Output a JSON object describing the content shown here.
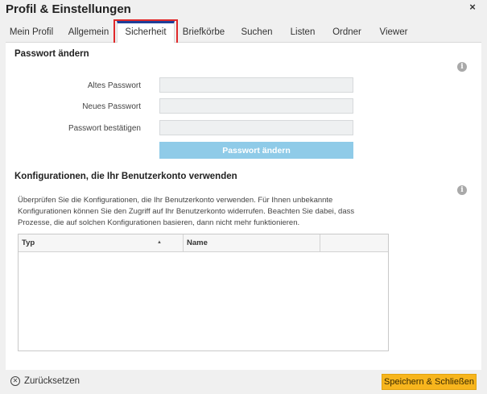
{
  "dialog": {
    "title": "Profil & Einstellungen",
    "close_symbol": "×"
  },
  "tabs": [
    {
      "label": "Mein Profil",
      "active": false
    },
    {
      "label": "Allgemein",
      "active": false
    },
    {
      "label": "Sicherheit",
      "active": true
    },
    {
      "label": "Briefkörbe",
      "active": false
    },
    {
      "label": "Suchen",
      "active": false
    },
    {
      "label": "Listen",
      "active": false
    },
    {
      "label": "Ordner",
      "active": false
    },
    {
      "label": "Viewer",
      "active": false
    }
  ],
  "password": {
    "title": "Passwort ändern",
    "old_label": "Altes Passwort",
    "old_value": "",
    "new_label": "Neues Passwort",
    "new_value": "",
    "confirm_label": "Passwort bestätigen",
    "confirm_value": "",
    "button_label": "Passwort ändern"
  },
  "configurations": {
    "title": "Konfigurationen, die Ihr Benutzerkonto verwenden",
    "description_lines": [
      "Überprüfen Sie die Konfigurationen, die Ihr Benutzerkonto verwenden. Für Ihnen unbekannte",
      "Konfigurationen können Sie den Zugriff auf Ihr Benutzerkonto widerrufen. Beachten Sie dabei, dass",
      "Prozesse, die auf solchen Konfigurationen basieren, dann nicht mehr funktionieren."
    ],
    "columns": [
      "Typ",
      "Name",
      ""
    ],
    "sort_indicator": "▲",
    "rows": []
  },
  "info_symbol": "i",
  "footer": {
    "reset_symbol": "✕",
    "reset_label": "Zurücksetzen",
    "save_label": "Speichern & Schließen"
  },
  "colors": {
    "active_tab_accent": "#1f3f99",
    "highlight_border": "#e0292b",
    "primary_button": "#8fcbe8",
    "save_button": "#f7b51d"
  }
}
